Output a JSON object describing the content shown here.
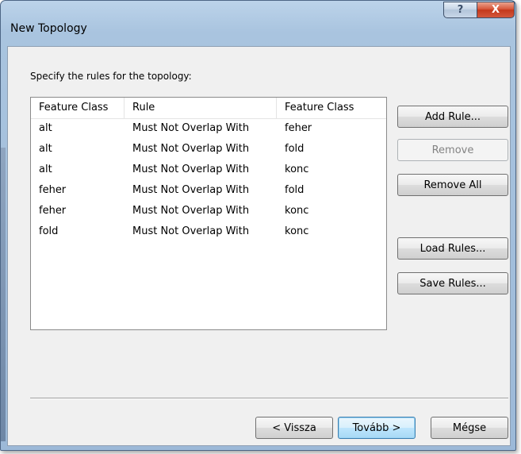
{
  "window": {
    "title": "New Topology",
    "help_glyph": "?",
    "close_glyph": "X"
  },
  "prompt": "Specify the rules for the topology:",
  "table": {
    "headers": [
      "Feature Class",
      "Rule",
      "Feature Class"
    ],
    "rows": [
      [
        "alt",
        "Must Not Overlap With",
        "feher"
      ],
      [
        "alt",
        "Must Not Overlap With",
        "fold"
      ],
      [
        "alt",
        "Must Not Overlap With",
        "konc"
      ],
      [
        "feher",
        "Must Not Overlap With",
        "fold"
      ],
      [
        "feher",
        "Must Not Overlap With",
        "konc"
      ],
      [
        "fold",
        "Must Not Overlap With",
        "konc"
      ]
    ]
  },
  "buttons": {
    "add_rule": "Add Rule...",
    "remove": "Remove",
    "remove_all": "Remove All",
    "load_rules": "Load Rules...",
    "save_rules": "Save Rules...",
    "back": "< Vissza",
    "next": "Tovább >",
    "cancel": "Mégse"
  },
  "colors": {
    "close_button": "#c4381b",
    "default_button_border": "#3c7fb1"
  }
}
